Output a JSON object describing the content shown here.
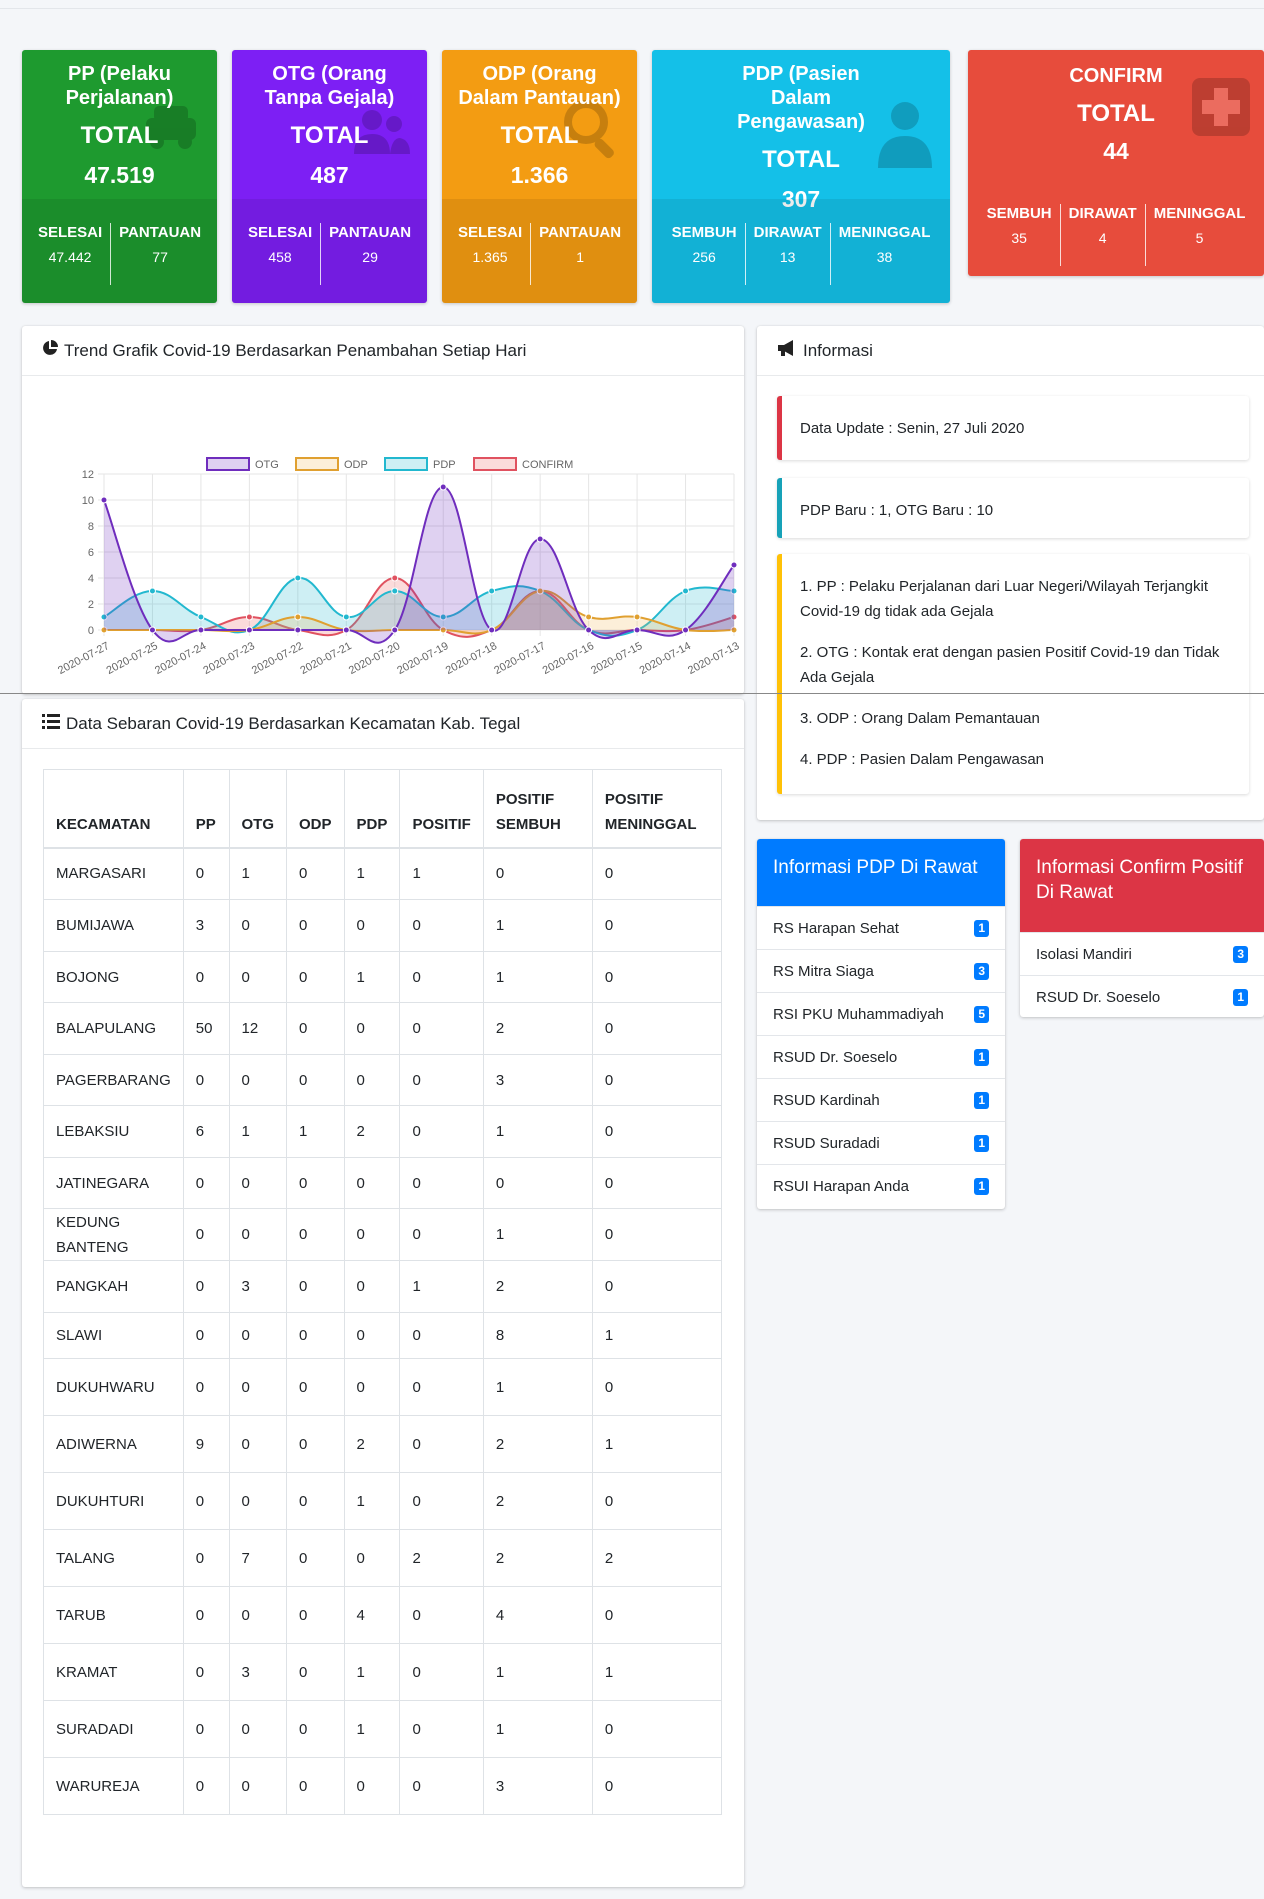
{
  "boxes": {
    "pp": {
      "title": "PP (Pelaku Perjalanan)",
      "total_label": "TOTAL",
      "total": "47.519",
      "color": "#1e9a2f",
      "stats": [
        {
          "label": "SELESAI",
          "value": "47.442"
        },
        {
          "label": "PANTAUAN",
          "value": "77"
        }
      ]
    },
    "otg": {
      "title": "OTG (Orang Tanpa Gejala)",
      "total_label": "TOTAL",
      "total": "487",
      "color": "#7d1ff4",
      "stats": [
        {
          "label": "SELESAI",
          "value": "458"
        },
        {
          "label": "PANTAUAN",
          "value": "29"
        }
      ]
    },
    "odp": {
      "title": "ODP (Orang Dalam Pantauan)",
      "total_label": "TOTAL",
      "total": "1.366",
      "color": "#f39c12",
      "stats": [
        {
          "label": "SELESAI",
          "value": "1.365"
        },
        {
          "label": "PANTAUAN",
          "value": "1"
        }
      ]
    },
    "pdp": {
      "title": "PDP (Pasien Dalam Pengawasan)",
      "total_label": "TOTAL",
      "total": "307",
      "color": "#14c0e8",
      "stats": [
        {
          "label": "SEMBUH",
          "value": "256"
        },
        {
          "label": "DIRAWAT",
          "value": "13"
        },
        {
          "label": "MENINGGAL",
          "value": "38"
        }
      ]
    },
    "confirm": {
      "title": "CONFIRM",
      "total_label": "TOTAL",
      "total": "44",
      "color": "#e74c3c",
      "stats": [
        {
          "label": "SEMBUH",
          "value": "35"
        },
        {
          "label": "DIRAWAT",
          "value": "4"
        },
        {
          "label": "MENINGGAL",
          "value": "5"
        }
      ]
    }
  },
  "trend": {
    "title": "Trend Grafik Covid-19 Berdasarkan Penambahan Setiap Hari",
    "icon": "chart-pie-icon"
  },
  "chart_data": {
    "type": "area",
    "categories": [
      "2020-07-27",
      "2020-07-25",
      "2020-07-24",
      "2020-07-23",
      "2020-07-22",
      "2020-07-21",
      "2020-07-20",
      "2020-07-19",
      "2020-07-18",
      "2020-07-17",
      "2020-07-16",
      "2020-07-15",
      "2020-07-14",
      "2020-07-13"
    ],
    "ylim": [
      0,
      12
    ],
    "yticks": [
      0,
      2,
      4,
      6,
      8,
      10,
      12
    ],
    "legend_position": "top",
    "grid": true,
    "series": [
      {
        "name": "OTG",
        "color": "#6f2dbd",
        "fill": "rgba(111,45,189,0.22)",
        "values": [
          10,
          0,
          0,
          0,
          0,
          0,
          0,
          11,
          0,
          7,
          0,
          0,
          0,
          5
        ]
      },
      {
        "name": "ODP",
        "color": "#e0a030",
        "fill": "rgba(240,180,80,0.22)",
        "values": [
          0,
          0,
          0,
          0,
          1,
          0,
          0,
          0,
          0,
          3,
          1,
          1,
          0,
          0
        ]
      },
      {
        "name": "PDP",
        "color": "#22b8cf",
        "fill": "rgba(34,184,207,0.22)",
        "values": [
          1,
          3,
          1,
          0,
          4,
          1,
          3,
          1,
          3,
          3,
          0,
          0,
          3,
          3
        ]
      },
      {
        "name": "CONFIRM",
        "color": "#e05260",
        "fill": "rgba(240,110,110,0.25)",
        "values": [
          0,
          0,
          0,
          1,
          0,
          0,
          4,
          0,
          0,
          3,
          0,
          0,
          0,
          1
        ]
      }
    ]
  },
  "info": {
    "title": "Informasi",
    "icon": "megaphone-icon",
    "update": "Data Update : Senin, 27 Juli 2020",
    "baru": "PDP Baru : 1, OTG Baru : 10",
    "defs": [
      "1. PP : Pelaku Perjalanan dari Luar Negeri/Wilayah Terjangkit Covid-19 dg tidak ada Gejala",
      "2. OTG : Kontak erat dengan pasien Positif Covid-19 dan Tidak Ada Gejala",
      "3. ODP : Orang Dalam Pemantauan",
      "4. PDP : Pasien Dalam Pengawasan"
    ],
    "colors": {
      "update": "#dc3545",
      "baru": "#17a2b8",
      "defs": "#ffc107"
    }
  },
  "sebaran": {
    "title": "Data Sebaran Covid-19 Berdasarkan Kecamatan Kab. Tegal",
    "icon": "list-icon",
    "headers": [
      "KECAMATAN",
      "PP",
      "OTG",
      "ODP",
      "PDP",
      "POSITIF",
      "POSITIF SEMBUH",
      "POSITIF MENINGGAL"
    ],
    "rows": [
      [
        "MARGASARI",
        "0",
        "1",
        "0",
        "1",
        "1",
        "0",
        "0"
      ],
      [
        "BUMIJAWA",
        "3",
        "0",
        "0",
        "0",
        "0",
        "1",
        "0"
      ],
      [
        "BOJONG",
        "0",
        "0",
        "0",
        "1",
        "0",
        "1",
        "0"
      ],
      [
        "BALAPULANG",
        "50",
        "12",
        "0",
        "0",
        "0",
        "2",
        "0"
      ],
      [
        "PAGERBARANG",
        "0",
        "0",
        "0",
        "0",
        "0",
        "3",
        "0"
      ],
      [
        "LEBAKSIU",
        "6",
        "1",
        "1",
        "2",
        "0",
        "1",
        "0"
      ],
      [
        "JATINEGARA",
        "0",
        "0",
        "0",
        "0",
        "0",
        "0",
        "0"
      ],
      [
        "KEDUNG BANTENG",
        "0",
        "0",
        "0",
        "0",
        "0",
        "1",
        "0"
      ],
      [
        "PANGKAH",
        "0",
        "3",
        "0",
        "0",
        "1",
        "2",
        "0"
      ],
      [
        "SLAWI",
        "0",
        "0",
        "0",
        "0",
        "0",
        "8",
        "1"
      ],
      [
        "DUKUHWARU",
        "0",
        "0",
        "0",
        "0",
        "0",
        "1",
        "0"
      ],
      [
        "ADIWERNA",
        "9",
        "0",
        "0",
        "2",
        "0",
        "2",
        "1"
      ],
      [
        "DUKUHTURI",
        "0",
        "0",
        "0",
        "1",
        "0",
        "2",
        "0"
      ],
      [
        "TALANG",
        "0",
        "7",
        "0",
        "0",
        "2",
        "2",
        "2"
      ],
      [
        "TARUB",
        "0",
        "0",
        "0",
        "4",
        "0",
        "4",
        "0"
      ],
      [
        "KRAMAT",
        "0",
        "3",
        "0",
        "1",
        "0",
        "1",
        "1"
      ],
      [
        "SURADADI",
        "0",
        "0",
        "0",
        "1",
        "0",
        "1",
        "0"
      ],
      [
        "WARUREJA",
        "0",
        "0",
        "0",
        "0",
        "0",
        "3",
        "0"
      ]
    ]
  },
  "pdp_rawat": {
    "title": "Informasi PDP Di Rawat",
    "color": "#007bff",
    "items": [
      {
        "label": "RS Harapan Sehat",
        "count": "1"
      },
      {
        "label": "RS Mitra Siaga",
        "count": "3"
      },
      {
        "label": "RSI PKU Muhammadiyah",
        "count": "5"
      },
      {
        "label": "RSUD Dr. Soeselo",
        "count": "1"
      },
      {
        "label": "RSUD Kardinah",
        "count": "1"
      },
      {
        "label": "RSUD Suradadi",
        "count": "1"
      },
      {
        "label": "RSUI Harapan Anda",
        "count": "1"
      }
    ]
  },
  "confirm_rawat": {
    "title": "Informasi Confirm Positif Di Rawat",
    "color": "#dc3545",
    "items": [
      {
        "label": "Isolasi Mandiri",
        "count": "3"
      },
      {
        "label": "RSUD Dr. Soeselo",
        "count": "1"
      }
    ]
  }
}
